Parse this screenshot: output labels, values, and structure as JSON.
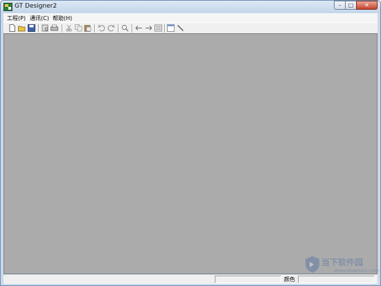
{
  "window": {
    "title": "GT Designer2"
  },
  "title_buttons": {
    "minimize": "–",
    "maximize": "□",
    "close": "✕"
  },
  "menu": {
    "items": [
      {
        "label": "工程(P)"
      },
      {
        "label": "通讯(C)"
      },
      {
        "label": "帮助(H)"
      }
    ]
  },
  "toolbar": {
    "buttons": [
      "new-file-icon",
      "open-folder-icon",
      "save-icon",
      "print-preview-icon",
      "print-icon",
      "cut-icon",
      "copy-icon",
      "paste-icon",
      "undo-icon",
      "redo-icon",
      "find-icon",
      "back-arrow-icon",
      "forward-arrow-icon",
      "screen-list-icon",
      "properties-icon",
      "line-tool-icon"
    ]
  },
  "statusbar": {
    "color_label": "颜色"
  },
  "watermark": {
    "text": "当下软件园",
    "url": "www.downxia.com"
  }
}
